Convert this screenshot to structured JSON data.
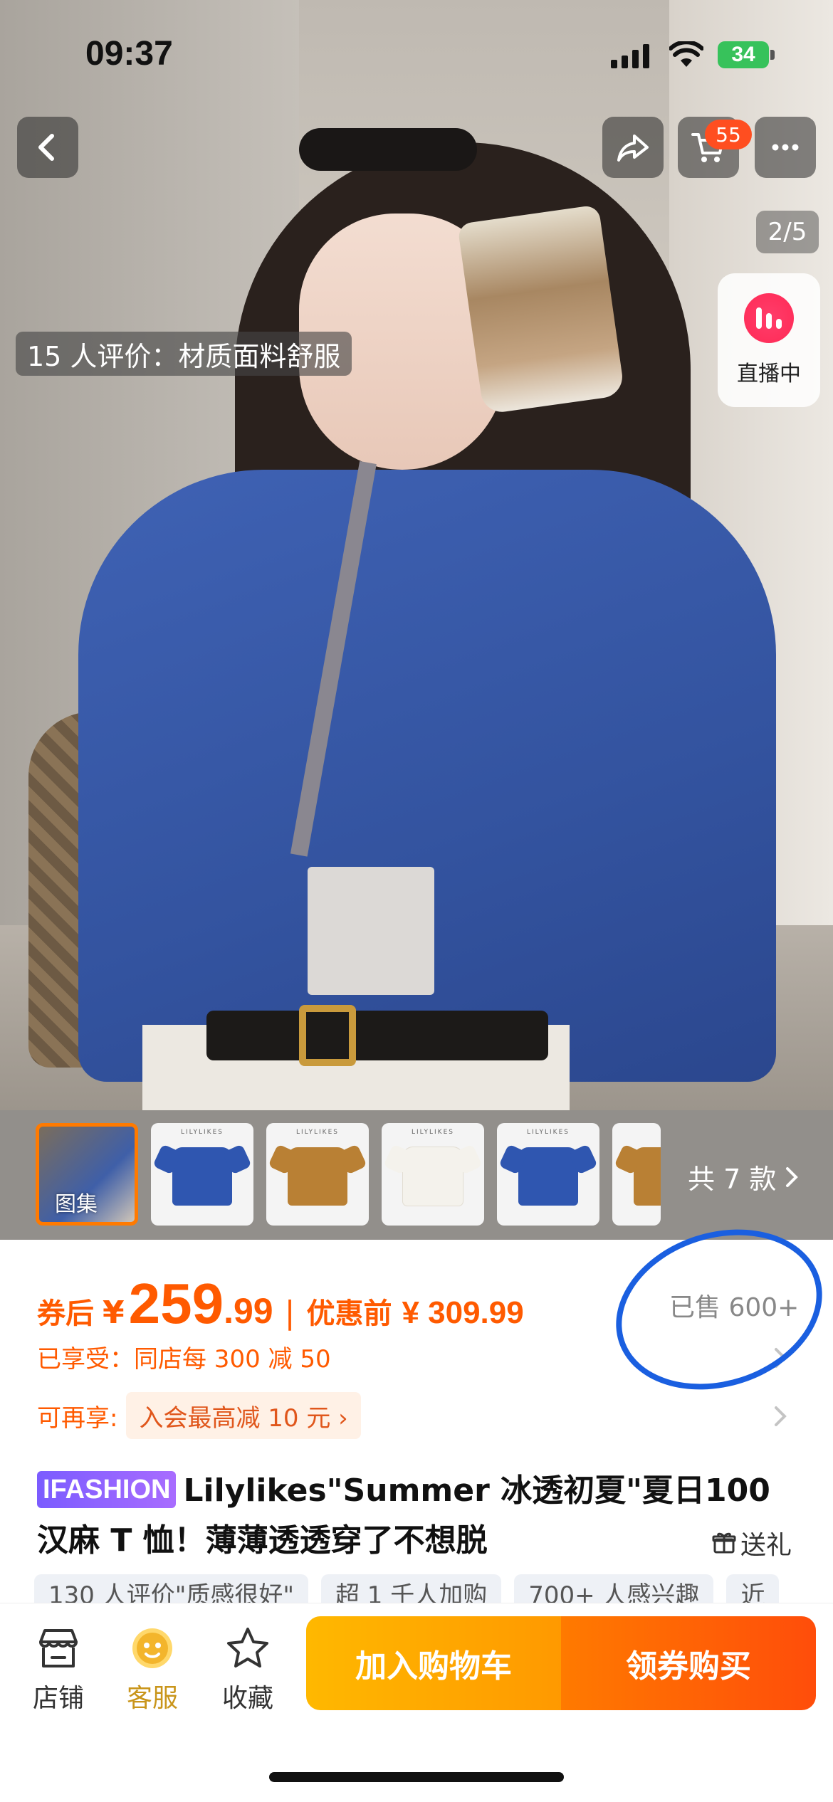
{
  "status_bar": {
    "time": "09:37",
    "battery": "34"
  },
  "nav": {
    "cart_badge": "55",
    "pager": "2/5"
  },
  "live": {
    "label": "直播中"
  },
  "review_tag": "15 人评价：材质面料舒服",
  "thumbs": {
    "first_label": "图集",
    "styles_count": "共 7 款",
    "brand_text": "LILYLIKES",
    "tee_colors": [
      "#2f56b0",
      "#b98034",
      "#f4f2ec",
      "#2f56b0",
      "#b98034"
    ]
  },
  "price": {
    "after_label": "券后",
    "yen": "¥",
    "main": "259",
    "decimal": ".99",
    "separator": "|",
    "before_label": "优惠前",
    "original": "¥ 309.99",
    "sold": "已售 600+"
  },
  "promo": {
    "enjoyed": "已享受：同店每 300 减 50",
    "more_label": "可再享:",
    "more_chip": "入会最高减 10 元 ›"
  },
  "product": {
    "brand_badge": "IFASHION",
    "title": "Lilylikes\"Summer 冰透初夏\"夏日100汉麻 T 恤！薄薄透透穿了不想脱",
    "gift": "送礼"
  },
  "chips": [
    "130 人评价\"质感很好\"",
    "超 1 千人加购",
    "700+ 人感兴趣",
    "近"
  ],
  "bottom_bar": {
    "store": "店铺",
    "service": "客服",
    "favorite": "收藏",
    "add_cart": "加入购物车",
    "buy": "领券购买"
  },
  "colors": {
    "accent": "#ff5a00",
    "cart_grad_start": "#ffb800",
    "buy_grad_end": "#ff4d0a",
    "annotation_circle": "#1a5fe0"
  }
}
